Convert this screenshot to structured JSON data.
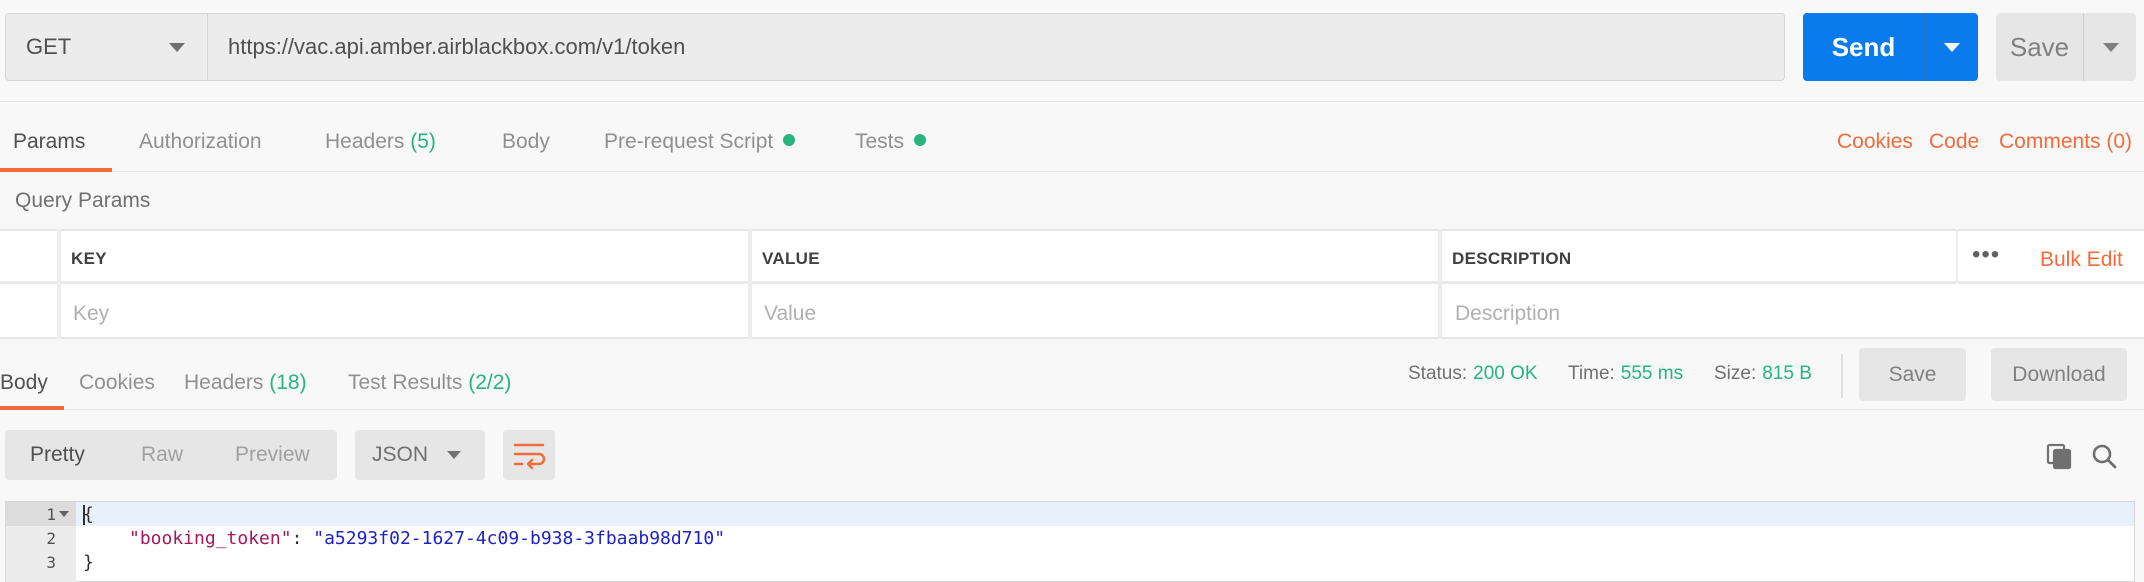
{
  "request": {
    "method": "GET",
    "url": "https://vac.api.amber.airblackbox.com/v1/token",
    "send_label": "Send",
    "save_label": "Save"
  },
  "request_tabs": {
    "params": "Params",
    "authorization": "Authorization",
    "headers": "Headers",
    "headers_count": "(5)",
    "body": "Body",
    "prerequest": "Pre-request Script",
    "tests": "Tests",
    "cookies": "Cookies",
    "code": "Code",
    "comments": "Comments (0)"
  },
  "query_params": {
    "title": "Query Params",
    "columns": [
      "KEY",
      "VALUE",
      "DESCRIPTION"
    ],
    "placeholders": [
      "Key",
      "Value",
      "Description"
    ],
    "more": "•••",
    "bulk_edit": "Bulk Edit"
  },
  "response": {
    "tabs": {
      "body": "Body",
      "cookies": "Cookies",
      "headers": "Headers",
      "headers_count": "(18)",
      "tests": "Test Results",
      "tests_count": "(2/2)"
    },
    "status_label": "Status:",
    "status_value": "200 OK",
    "time_label": "Time:",
    "time_value": "555 ms",
    "size_label": "Size:",
    "size_value": "815 B",
    "save_label": "Save",
    "download_label": "Download"
  },
  "body_toolbar": {
    "modes": [
      "Pretty",
      "Raw",
      "Preview"
    ],
    "format": "JSON"
  },
  "editor": {
    "line_numbers": [
      "1",
      "2",
      "3"
    ],
    "open_brace": "{",
    "close_brace": "}",
    "key": "\"booking_token\"",
    "colon": ": ",
    "value": "\"a5293f02-1627-4c09-b938-3fbaab98d710\""
  },
  "colors": {
    "accent": "#f26b3a",
    "primary": "#097bed",
    "success": "#26b47f"
  }
}
